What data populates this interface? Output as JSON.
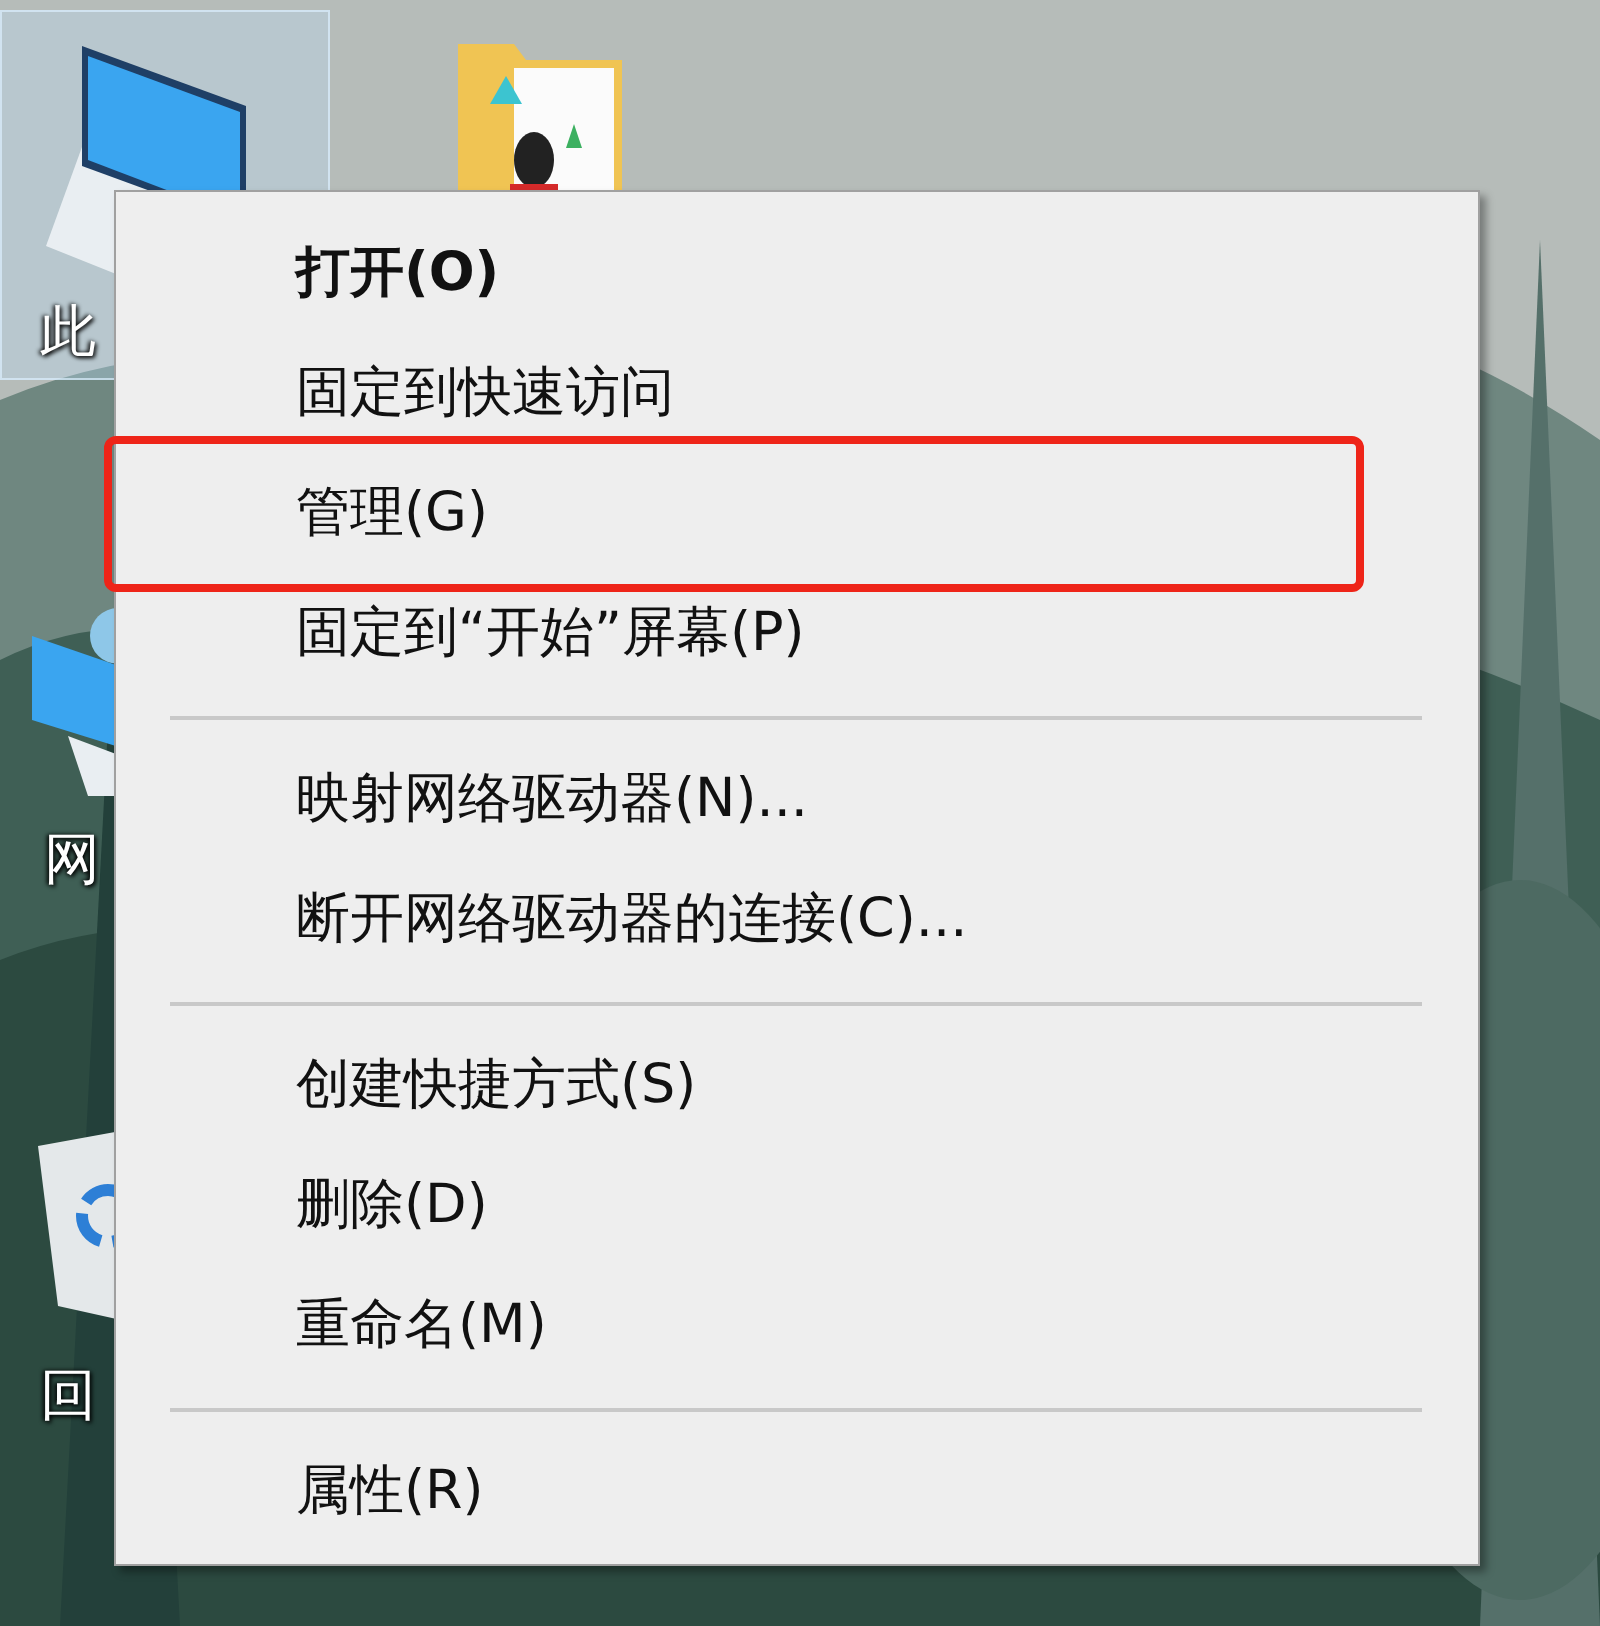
{
  "desktop_icons": [
    {
      "kind": "computer",
      "label": "此",
      "selected": true
    },
    {
      "kind": "folder",
      "selected": false
    },
    {
      "kind": "network",
      "label": "网",
      "selected": false
    },
    {
      "kind": "recycle_bin",
      "label": "回",
      "selected": false
    }
  ],
  "context_menu": {
    "items": [
      {
        "kind": "item",
        "label": "打开(O)",
        "default": true,
        "highlighted": false
      },
      {
        "kind": "item",
        "label": "固定到快速访问",
        "default": false,
        "highlighted": false
      },
      {
        "kind": "item",
        "label": "管理(G)",
        "default": false,
        "highlighted": true
      },
      {
        "kind": "item",
        "label": "固定到“开始”屏幕(P)",
        "default": false,
        "highlighted": false
      },
      {
        "kind": "separator"
      },
      {
        "kind": "item",
        "label": "映射网络驱动器(N)...",
        "default": false,
        "highlighted": false
      },
      {
        "kind": "item",
        "label": "断开网络驱动器的连接(C)...",
        "default": false,
        "highlighted": false
      },
      {
        "kind": "separator"
      },
      {
        "kind": "item",
        "label": "创建快捷方式(S)",
        "default": false,
        "highlighted": false
      },
      {
        "kind": "item",
        "label": "删除(D)",
        "default": false,
        "highlighted": false
      },
      {
        "kind": "item",
        "label": "重命名(M)",
        "default": false,
        "highlighted": false
      },
      {
        "kind": "separator"
      },
      {
        "kind": "item",
        "label": "属性(R)",
        "default": false,
        "highlighted": false
      }
    ]
  }
}
